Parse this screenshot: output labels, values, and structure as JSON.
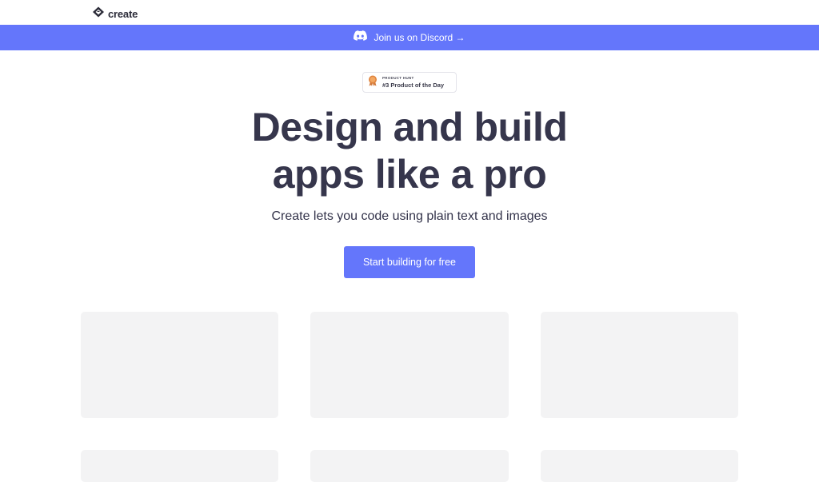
{
  "header": {
    "logo_icon": "create-logo-icon",
    "logo_text": "create"
  },
  "announcement": {
    "icon": "discord-icon",
    "text": "Join us on Discord →",
    "background_color": "#6476fb"
  },
  "product_hunt_badge": {
    "icon": "medal-icon",
    "label_small": "PRODUCT HUNT",
    "label_large": "#3 Product of the Day"
  },
  "hero": {
    "title_line1": "Design and build",
    "title_line2": "apps like a pro",
    "subtitle": "Create lets you code using plain text and images",
    "cta_label": "Start building for free",
    "accent_color": "#6476fb"
  },
  "gallery": {
    "card_color": "#f3f3f4",
    "card_count": 6
  }
}
